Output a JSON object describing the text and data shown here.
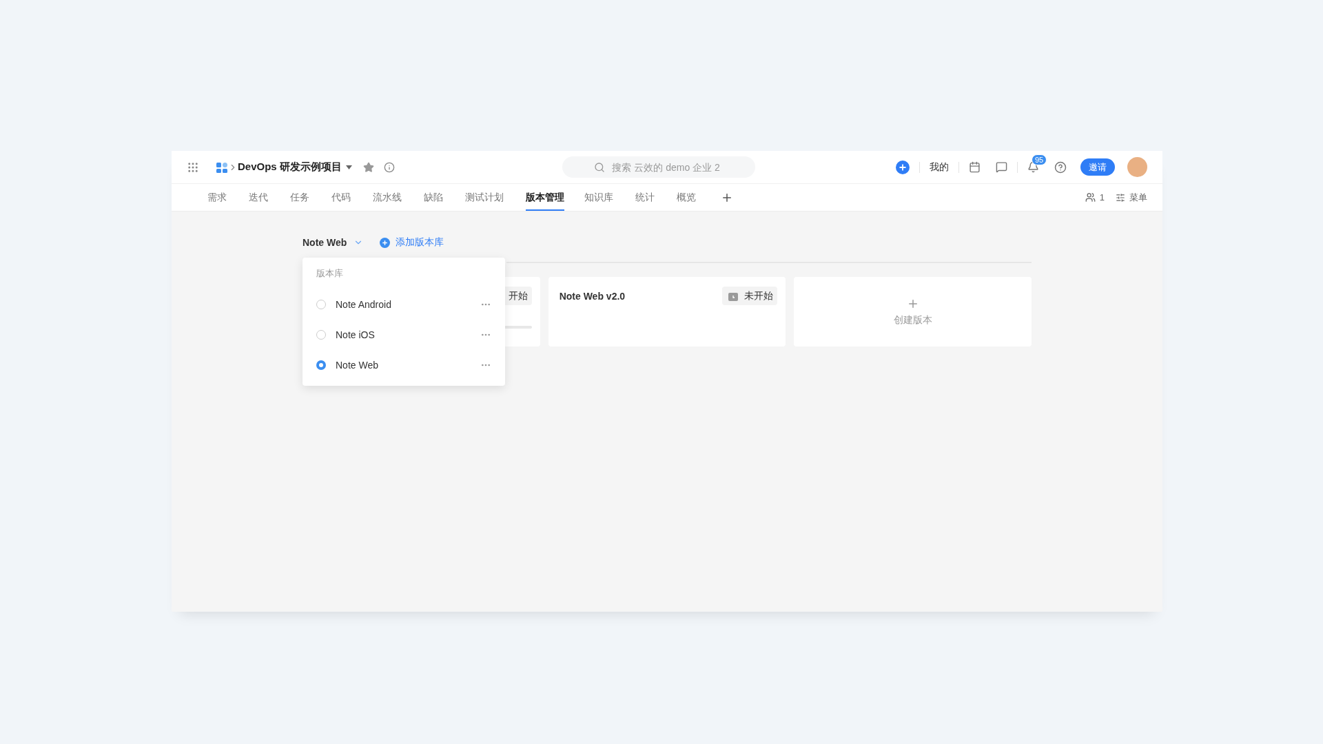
{
  "topbar": {
    "project": "DevOps 研发示例项目",
    "search": {
      "placeholder": "搜索 云效的 demo 企业 2"
    },
    "mine": "我的",
    "notifications": "95",
    "invite": "邀请"
  },
  "tabs": [
    {
      "label": "需求",
      "selected": false
    },
    {
      "label": "迭代",
      "selected": false
    },
    {
      "label": "任务",
      "selected": false
    },
    {
      "label": "代码",
      "selected": false
    },
    {
      "label": "流水线",
      "selected": false
    },
    {
      "label": "缺陷",
      "selected": false
    },
    {
      "label": "测试计划",
      "selected": false
    },
    {
      "label": "版本管理",
      "selected": true
    },
    {
      "label": "知识库",
      "selected": false
    },
    {
      "label": "统计",
      "selected": false
    },
    {
      "label": "概览",
      "selected": false
    }
  ],
  "tab_tools": {
    "members": "1",
    "menu": "菜单"
  },
  "repo_selector": {
    "value": "Note Web",
    "add": "添加版本库"
  },
  "versions": [
    {
      "kind": "version",
      "status": "开始",
      "progress_bar": true
    },
    {
      "kind": "version",
      "title": "Note Web v2.0",
      "status": "未开始"
    },
    {
      "kind": "create",
      "label": "创建版本"
    }
  ],
  "dropdown": {
    "title": "版本库",
    "items": [
      {
        "name": "Note Android",
        "selected": false
      },
      {
        "name": "Note iOS",
        "selected": false
      },
      {
        "name": "Note Web",
        "selected": true
      }
    ]
  }
}
